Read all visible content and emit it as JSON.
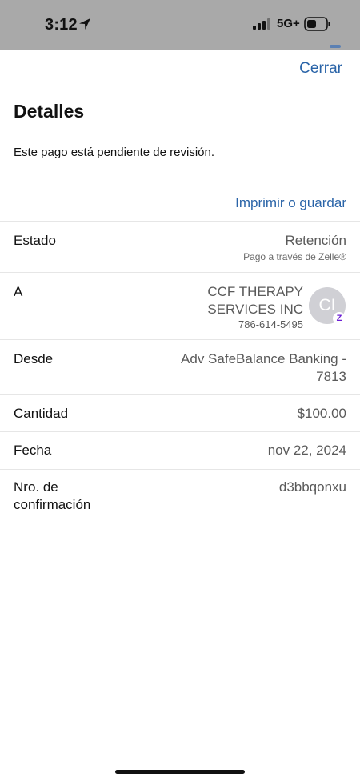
{
  "status_bar": {
    "time": "3:12",
    "network": "5G+"
  },
  "header": {
    "close_label": "Cerrar",
    "title": "Detalles"
  },
  "message": "Este pago está pendiente de revisión.",
  "print_save_label": "Imprimir o guardar",
  "details": {
    "status": {
      "label": "Estado",
      "value": "Retención",
      "subvalue": "Pago a través de Zelle®"
    },
    "to": {
      "label": "A",
      "name": "CCF THERAPY SERVICES INC",
      "phone": "786-614-5495",
      "avatar_initials": "CI",
      "badge": "Z",
      "badge_color": "#6d1ed4"
    },
    "from": {
      "label": "Desde",
      "value": "Adv SafeBalance Banking - 7813"
    },
    "amount": {
      "label": "Cantidad",
      "value": "$100.00"
    },
    "date": {
      "label": "Fecha",
      "value": "nov 22, 2024"
    },
    "confirmation": {
      "label": "Nro. de confirmación",
      "value": "d3bbqonxu"
    }
  },
  "colors": {
    "status_bar_bg": "#a9a9a9",
    "link": "#2a64a8",
    "avatar_bg": "#d0d0d5"
  },
  "icons": [
    "location-arrow-icon",
    "cellular-signal-icon",
    "battery-icon",
    "zelle-icon"
  ]
}
